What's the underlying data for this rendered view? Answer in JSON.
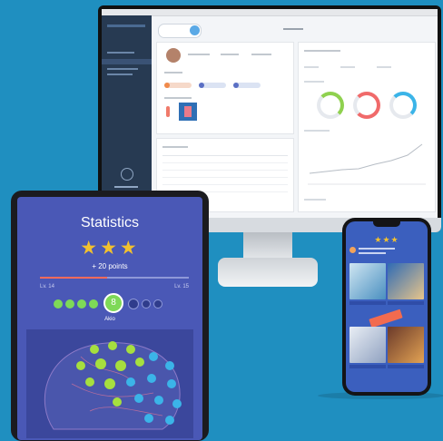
{
  "tablet": {
    "title": "Statistics",
    "stars": "★★★",
    "points": "+ 20 points",
    "level_left": "Lv. 14",
    "level_right": "Lv. 15",
    "progress_fraction": 0.45,
    "current_badge": "8",
    "current_label": "Akio"
  },
  "phone": {
    "stars": "★★★"
  },
  "colors": {
    "background": "#1f8fc0",
    "tablet_bg": "#4a58b6",
    "star": "#f2c12e",
    "progress": "#ff6b5b",
    "green": "#7ed957",
    "blue": "#3bb4e8",
    "phone_bg": "#3b5fbe"
  }
}
